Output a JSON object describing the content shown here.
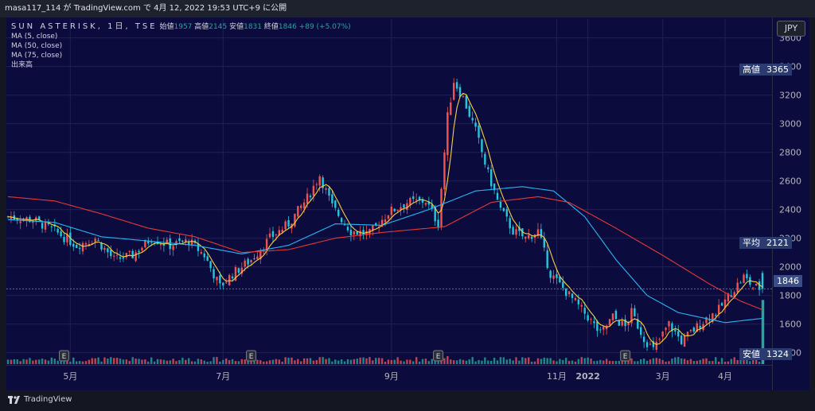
{
  "topbar": {
    "text": "masa117_114 が TradingView.com で 4月 12, 2022 19:53 UTC+9 に公開"
  },
  "legend": {
    "symbol": "SUN ASTERISK, 1日, TSE",
    "open_label": "始値",
    "open": "1957",
    "high_label": "高値",
    "high": "2145",
    "low_label": "安値",
    "low": "1831",
    "close_label": "終値",
    "close": "1846",
    "change": "+89 (+5.07%)",
    "ma_lines": [
      "MA (5, close)",
      "MA (50, close)",
      "MA (75, close)"
    ],
    "volume_label": "出来高"
  },
  "currency": "JPY",
  "tags": {
    "high": {
      "label": "高値",
      "value": "3365"
    },
    "avg": {
      "label": "平均",
      "value": "2121"
    },
    "last": {
      "value": "1846"
    },
    "low": {
      "label": "安値",
      "value": "1324"
    }
  },
  "footer": {
    "brand": "TradingView"
  },
  "colors": {
    "up": "#ef5350",
    "down": "#26c6da",
    "ma5": "#f5d142",
    "ma50": "#29b6f6",
    "ma75": "#e53935",
    "volume_up": "#ef5350",
    "volume_down": "#26a69a"
  },
  "chart_data": {
    "type": "candlestick",
    "x_tick_labels": [
      "5月",
      "7月",
      "9月",
      "11月",
      "2022",
      "3月",
      "4月"
    ],
    "y_ticks": [
      3600,
      3400,
      3200,
      3000,
      2800,
      2600,
      2400,
      2200,
      2000,
      1800,
      1600,
      1400
    ],
    "ylim": [
      1320,
      3620
    ],
    "earnings_marker": "E",
    "anchors": [
      [
        0,
        2350
      ],
      [
        8,
        2330
      ],
      [
        15,
        2250
      ],
      [
        22,
        2150
      ],
      [
        28,
        2200
      ],
      [
        34,
        2050
      ],
      [
        40,
        2080
      ],
      [
        46,
        2200
      ],
      [
        52,
        2150
      ],
      [
        58,
        2180
      ],
      [
        63,
        2080
      ],
      [
        68,
        1860
      ],
      [
        72,
        1950
      ],
      [
        78,
        2050
      ],
      [
        84,
        2200
      ],
      [
        90,
        2300
      ],
      [
        96,
        2480
      ],
      [
        100,
        2640
      ],
      [
        104,
        2420
      ],
      [
        110,
        2250
      ],
      [
        116,
        2230
      ],
      [
        122,
        2380
      ],
      [
        128,
        2450
      ],
      [
        134,
        2460
      ],
      [
        138,
        2300
      ],
      [
        141,
        3050
      ],
      [
        143,
        3300
      ],
      [
        146,
        3180
      ],
      [
        150,
        2950
      ],
      [
        154,
        2650
      ],
      [
        158,
        2400
      ],
      [
        162,
        2250
      ],
      [
        166,
        2200
      ],
      [
        170,
        2250
      ],
      [
        174,
        1950
      ],
      [
        180,
        1800
      ],
      [
        186,
        1650
      ],
      [
        190,
        1530
      ],
      [
        194,
        1650
      ],
      [
        198,
        1580
      ],
      [
        200,
        1680
      ],
      [
        204,
        1500
      ],
      [
        207,
        1420
      ],
      [
        212,
        1600
      ],
      [
        216,
        1480
      ],
      [
        220,
        1560
      ],
      [
        224,
        1640
      ],
      [
        228,
        1700
      ],
      [
        232,
        1820
      ],
      [
        236,
        1930
      ],
      [
        239,
        1860
      ],
      [
        242,
        1846
      ]
    ],
    "ma50_anchors": [
      [
        0,
        2330
      ],
      [
        15,
        2310
      ],
      [
        30,
        2210
      ],
      [
        45,
        2180
      ],
      [
        60,
        2150
      ],
      [
        75,
        2090
      ],
      [
        90,
        2150
      ],
      [
        105,
        2300
      ],
      [
        120,
        2290
      ],
      [
        135,
        2400
      ],
      [
        150,
        2530
      ],
      [
        165,
        2560
      ],
      [
        175,
        2530
      ],
      [
        185,
        2350
      ],
      [
        195,
        2050
      ],
      [
        205,
        1800
      ],
      [
        215,
        1680
      ],
      [
        230,
        1610
      ],
      [
        242,
        1640
      ]
    ],
    "ma75_anchors": [
      [
        0,
        2490
      ],
      [
        15,
        2460
      ],
      [
        30,
        2370
      ],
      [
        45,
        2270
      ],
      [
        60,
        2210
      ],
      [
        75,
        2100
      ],
      [
        90,
        2120
      ],
      [
        105,
        2200
      ],
      [
        120,
        2240
      ],
      [
        140,
        2280
      ],
      [
        155,
        2450
      ],
      [
        170,
        2490
      ],
      [
        180,
        2450
      ],
      [
        195,
        2270
      ],
      [
        210,
        2080
      ],
      [
        225,
        1880
      ],
      [
        235,
        1760
      ],
      [
        242,
        1700
      ]
    ],
    "earnings_bars": [
      18,
      78,
      138,
      198
    ],
    "n_bars": 243
  }
}
